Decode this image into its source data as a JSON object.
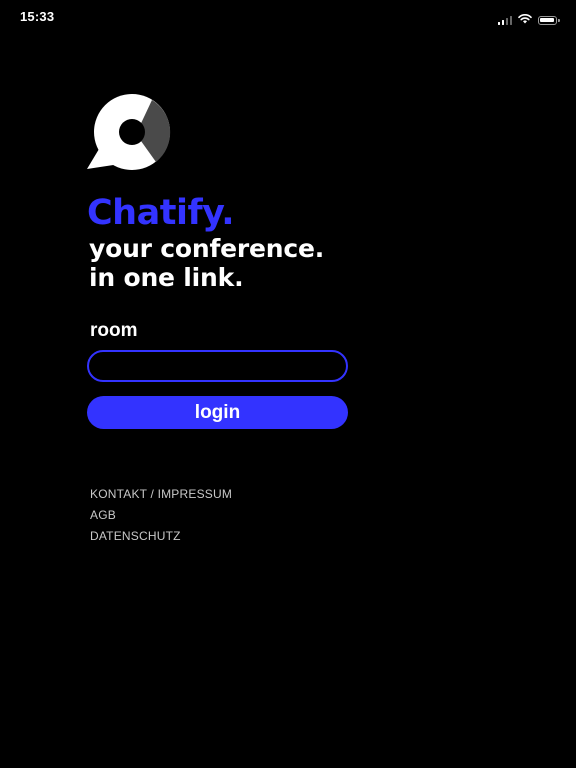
{
  "status_bar": {
    "time": "15:33",
    "icons": [
      "signal-icon",
      "wifi-icon",
      "battery-icon"
    ]
  },
  "logo": {
    "icon": "chat-bubble-logo-icon"
  },
  "brand": {
    "name": "Chatify.",
    "tagline_line1": "your conference.",
    "tagline_line2": "in one link."
  },
  "form": {
    "room_label": "room",
    "room_value": "",
    "room_placeholder": "",
    "login_label": "login"
  },
  "footer": {
    "links": [
      "KONTAKT / IMPRESSUM",
      "AGB",
      "DATENSCHUTZ"
    ]
  },
  "colors": {
    "background": "#000000",
    "accent": "#3333ff",
    "text": "#ffffff",
    "footer_text": "#c8c8c8"
  }
}
